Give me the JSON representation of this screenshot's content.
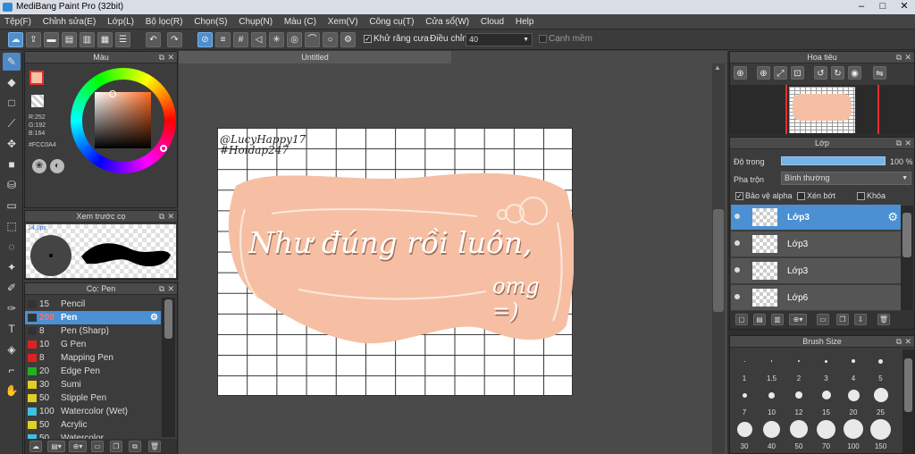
{
  "app": {
    "title": "MediBang Paint Pro (32bit)"
  },
  "menu": [
    "Tệp(F)",
    "Chỉnh sửa(E)",
    "Lớp(L)",
    "Bộ lọc(R)",
    "Chọn(S)",
    "Chụp(N)",
    "Màu (C)",
    "Xem(V)",
    "Công cụ(T)",
    "Cửa sổ(W)",
    "Cloud",
    "Help"
  ],
  "toolbar": {
    "antialias_label": "Khử răng cưa",
    "adjust_label": "Điều chỉnh",
    "adjust_value": "40",
    "snap_label": "Cạnh mềm"
  },
  "color_panel": {
    "title": "Màu",
    "r": "R:252",
    "g": "G:192",
    "b": "B:164",
    "hex": "#FCC0A4",
    "main_color": "#fcc0a4"
  },
  "preview_panel": {
    "title": "Xem trước cọ",
    "size_label": "14.0px"
  },
  "brush_panel": {
    "title": "Cọ: Pen",
    "items": [
      {
        "size": "15",
        "name": "Pencil",
        "color": "#333333",
        "selected": false
      },
      {
        "size": "200",
        "name": "Pen",
        "color": "#333333",
        "selected": true
      },
      {
        "size": "8",
        "name": "Pen (Sharp)",
        "color": "#333333",
        "selected": false
      },
      {
        "size": "10",
        "name": "G Pen",
        "color": "#e02020",
        "selected": false
      },
      {
        "size": "8",
        "name": "Mapping Pen",
        "color": "#e02020",
        "selected": false
      },
      {
        "size": "20",
        "name": "Edge Pen",
        "color": "#20b020",
        "selected": false
      },
      {
        "size": "30",
        "name": "Sumi",
        "color": "#e0d020",
        "selected": false
      },
      {
        "size": "50",
        "name": "Stipple Pen",
        "color": "#e0d020",
        "selected": false
      },
      {
        "size": "100",
        "name": "Watercolor (Wet)",
        "color": "#40c0e0",
        "selected": false
      },
      {
        "size": "50",
        "name": "Acrylic",
        "color": "#e0d020",
        "selected": false
      },
      {
        "size": "50",
        "name": "Watercolor",
        "color": "#40c0e0",
        "selected": false
      }
    ]
  },
  "document": {
    "tab_title": "Untitled",
    "watermark_line1": "@LucyHappy17",
    "watermark_line2": "#Hoidap247",
    "art_text_line1": "Như đúng rồi luôn,",
    "art_text_line2": "omg =)"
  },
  "navigator_panel": {
    "title": "Hoa tiêu"
  },
  "layer_panel": {
    "title": "Lớp",
    "opacity_label": "Độ trong",
    "opacity_value": "100 %",
    "blend_label": "Pha trộn",
    "blend_value": "Bình thường",
    "protect_alpha_label": "Bảo vệ alpha",
    "clip_label": "Xén bớt",
    "lock_label": "Khóa",
    "layers": [
      {
        "name": "Lớp3",
        "selected": true
      },
      {
        "name": "Lớp3",
        "selected": false
      },
      {
        "name": "Lớp3",
        "selected": false
      },
      {
        "name": "Lớp6",
        "selected": false
      }
    ]
  },
  "brush_size_panel": {
    "title": "Brush Size",
    "sizes": [
      "1",
      "1.5",
      "2",
      "3",
      "4",
      "5",
      "7",
      "10",
      "12",
      "15",
      "20",
      "25",
      "30",
      "40",
      "50",
      "70",
      "100",
      "150"
    ]
  }
}
